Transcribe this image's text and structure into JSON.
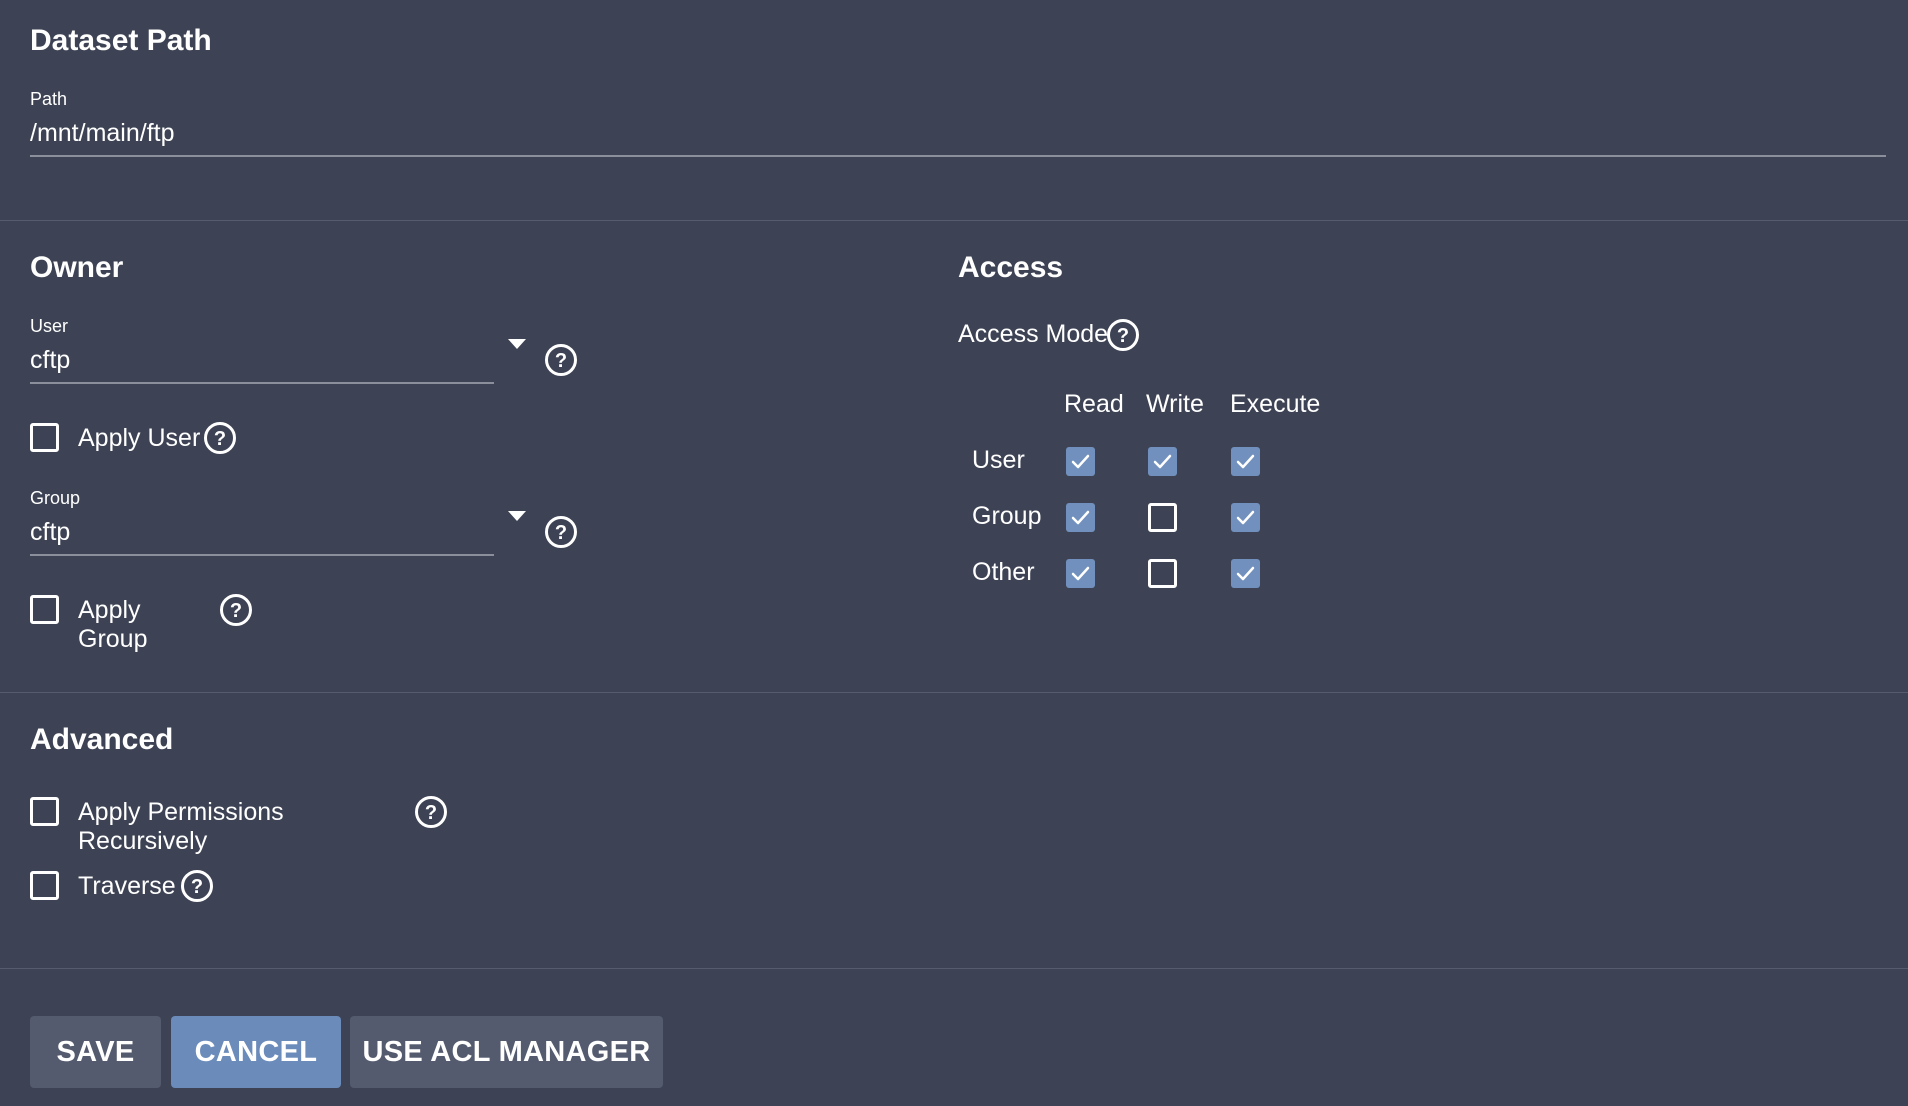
{
  "dataset_path": {
    "title": "Dataset Path",
    "path_label": "Path",
    "path_value": "/mnt/main/ftp"
  },
  "owner": {
    "title": "Owner",
    "user_label": "User",
    "user_value": "cftp",
    "apply_user_label": "Apply User",
    "apply_user_checked": false,
    "group_label": "Group",
    "group_value": "cftp",
    "apply_group_label": "Apply Group",
    "apply_group_checked": false
  },
  "access": {
    "title": "Access",
    "mode_label": "Access Mode",
    "columns": [
      "Read",
      "Write",
      "Execute"
    ],
    "rows": [
      {
        "label": "User",
        "read": true,
        "write": true,
        "execute": true
      },
      {
        "label": "Group",
        "read": true,
        "write": false,
        "execute": true
      },
      {
        "label": "Other",
        "read": true,
        "write": false,
        "execute": true
      }
    ]
  },
  "advanced": {
    "title": "Advanced",
    "recursive_label": "Apply Permissions Recursively",
    "recursive_checked": false,
    "traverse_label": "Traverse",
    "traverse_checked": false
  },
  "buttons": {
    "save": "SAVE",
    "cancel": "CANCEL",
    "acl": "USE ACL MANAGER"
  },
  "colors": {
    "background": "#3d4354",
    "checkbox_checked": "#7190bd",
    "button_primary": "#6b8bba",
    "button_default": "#545b6f"
  },
  "icons": {
    "help": "question-circle-icon",
    "dropdown": "caret-down-icon",
    "check": "checkmark-icon"
  }
}
